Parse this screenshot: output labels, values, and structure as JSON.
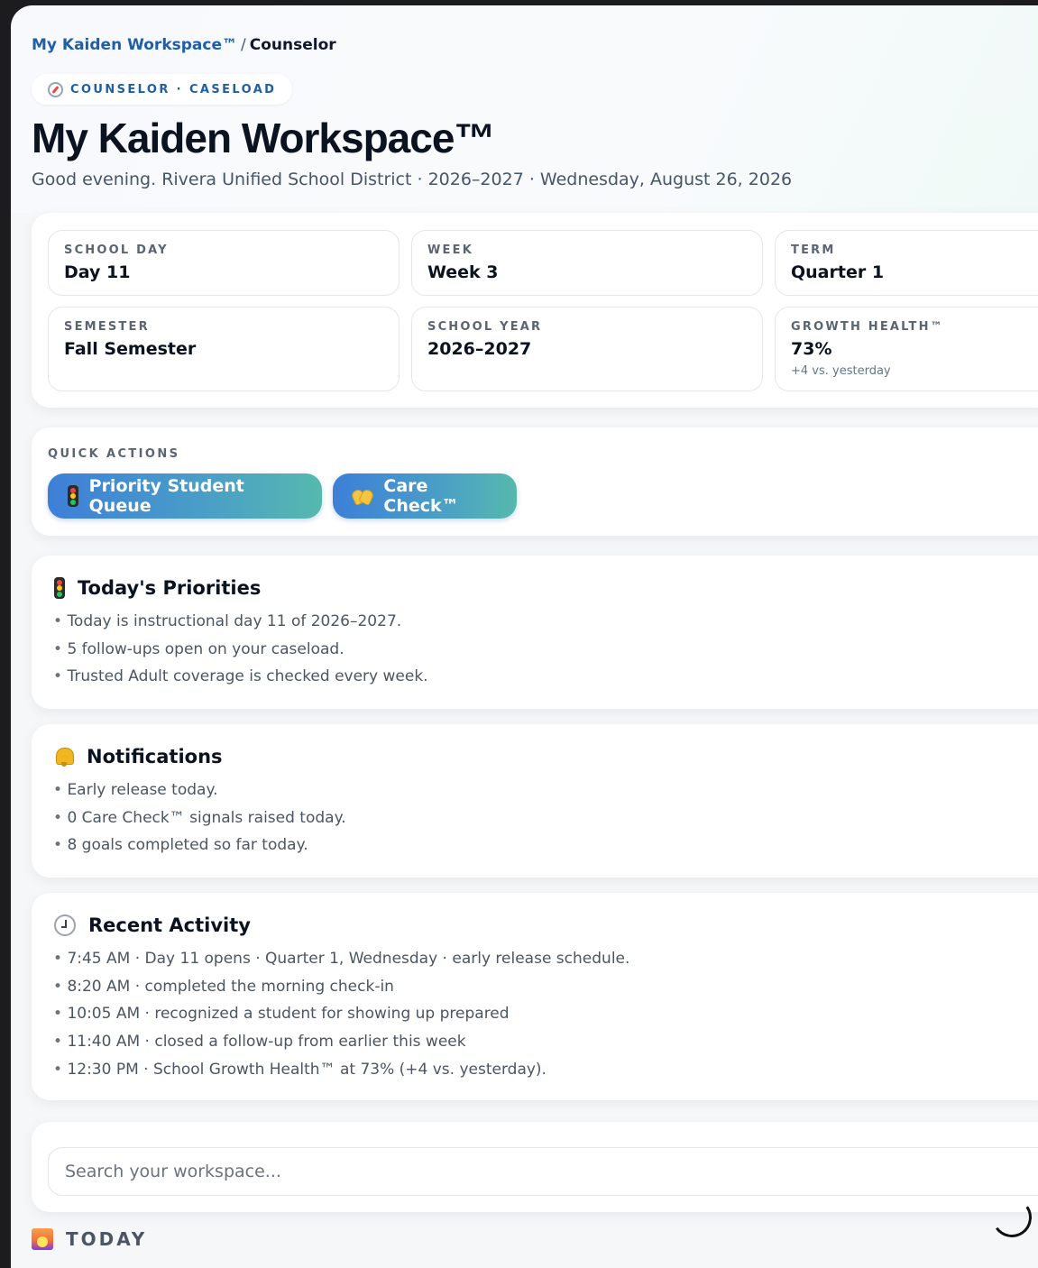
{
  "breadcrumb": {
    "root": "My Kaiden Workspace™",
    "separator": "/",
    "current": "Counselor"
  },
  "role_pill": {
    "icon": "compass-icon",
    "text": "COUNSELOR · CASELOAD"
  },
  "header": {
    "title": "My Kaiden Workspace™",
    "subtitle": "Good evening. Rivera Unified School District · 2026–2027 · Wednesday, August 26, 2026"
  },
  "stats": [
    {
      "label": "SCHOOL DAY",
      "value": "Day 11"
    },
    {
      "label": "WEEK",
      "value": "Week 3"
    },
    {
      "label": "TERM",
      "value": "Quarter 1"
    },
    {
      "label": "SEMESTER",
      "value": "Fall Semester"
    },
    {
      "label": "SCHOOL YEAR",
      "value": "2026–2027"
    },
    {
      "label": "GROWTH HEALTH™",
      "value": "73%",
      "sub": "+4 vs. yesterday"
    }
  ],
  "quick_actions": {
    "label": "QUICK ACTIONS",
    "buttons": [
      {
        "label": "Priority Student Queue",
        "icon": "traffic-light-icon"
      },
      {
        "label": "Care Check™",
        "icon": "heart-hands-icon"
      }
    ]
  },
  "priorities": {
    "title": "Today's Priorities",
    "icon": "traffic-light-icon",
    "items": [
      "Today is instructional day 11 of 2026–2027.",
      "5 follow-ups open on your caseload.",
      "Trusted Adult coverage is checked every week."
    ]
  },
  "notifications": {
    "title": "Notifications",
    "icon": "bell-icon",
    "items": [
      "Early release today.",
      "0 Care Check™ signals raised today.",
      "8 goals completed so far today."
    ]
  },
  "recent_activity": {
    "title": "Recent Activity",
    "icon": "clock-icon",
    "items": [
      "7:45 AM · Day 11 opens · Quarter 1, Wednesday · early release schedule.",
      "8:20 AM · completed the morning check-in",
      "10:05 AM · recognized a student for showing up prepared",
      "11:40 AM · closed a follow-up from earlier this week",
      "12:30 PM · School Growth Health™ at 73% (+4 vs. yesterday)."
    ]
  },
  "search": {
    "placeholder": "Search your workspace...",
    "value": ""
  },
  "today": {
    "label": "TODAY",
    "icon": "sunrise-icon"
  },
  "colors": {
    "accent": "#1f5fa8",
    "button_gradient_start": "#3d7fd8",
    "button_gradient_end": "#56b9ad",
    "header_tint": "#e2f8f1"
  }
}
